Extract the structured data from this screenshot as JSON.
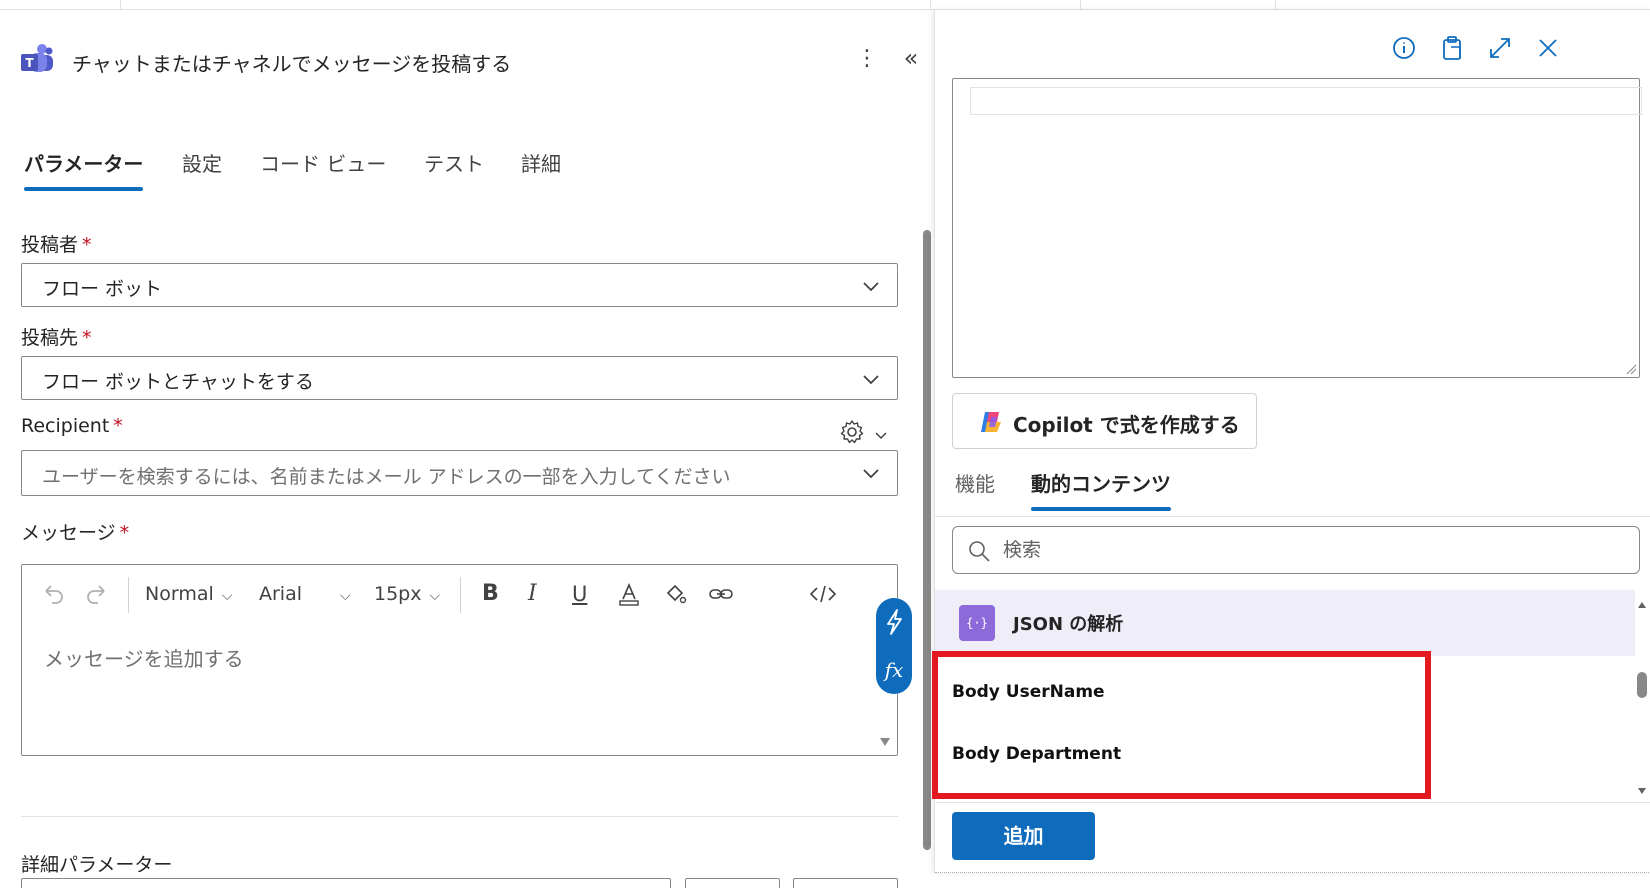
{
  "action": {
    "title": "チャットまたはチャネルでメッセージを投稿する",
    "icon": "microsoft-teams-icon"
  },
  "tabs": [
    {
      "label": "パラメーター",
      "active": true
    },
    {
      "label": "設定",
      "active": false
    },
    {
      "label": "コード ビュー",
      "active": false
    },
    {
      "label": "テスト",
      "active": false
    },
    {
      "label": "詳細",
      "active": false
    }
  ],
  "fields": {
    "post_as": {
      "label": "投稿者",
      "required_mark": "*",
      "value": "フロー ボット"
    },
    "post_in": {
      "label": "投稿先",
      "required_mark": "*",
      "value": "フロー ボットとチャットをする"
    },
    "recipient": {
      "label": "Recipient",
      "required_mark": "*",
      "placeholder": "ユーザーを検索するには、名前またはメール アドレスの一部を入力してください"
    },
    "message": {
      "label": "メッセージ",
      "required_mark": "*",
      "placeholder": "メッセージを追加する"
    }
  },
  "editor_toolbar": {
    "style": "Normal",
    "font": "Arial",
    "size": "15px"
  },
  "advanced": {
    "label": "詳細パラメーター"
  },
  "expression_panel": {
    "copilot_label": "Copilot で式を作成する",
    "tabs": [
      {
        "label": "機能",
        "active": false
      },
      {
        "label": "動的コンテンツ",
        "active": true
      }
    ],
    "search_placeholder": "検索",
    "group": {
      "title": "JSON の解析",
      "icon_glyph": "{·}"
    },
    "items": [
      "Body UserName",
      "Body Department"
    ],
    "add_label": "追加"
  },
  "colors": {
    "accent": "#0f6cbd",
    "required": "#c50f1f",
    "highlight": "#e3191f",
    "group_bg": "#efedf8",
    "group_icon": "#8c6ad9"
  }
}
